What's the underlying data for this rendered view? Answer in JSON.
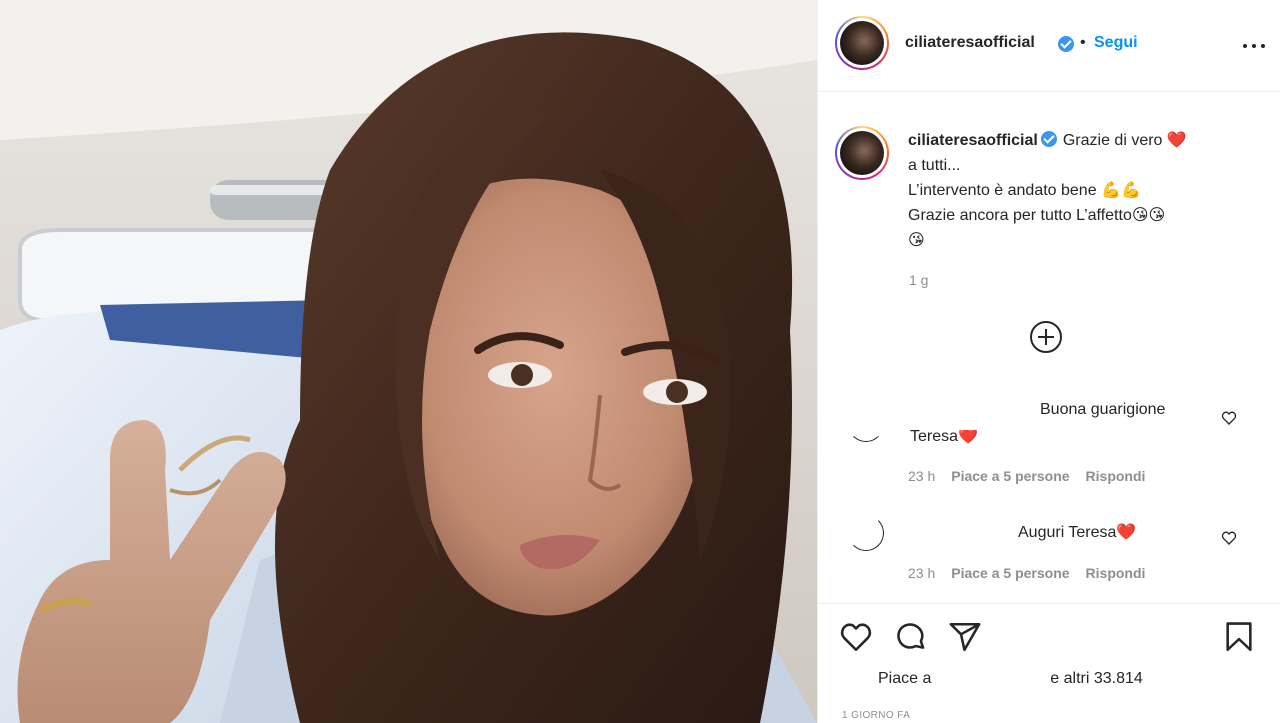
{
  "post": {
    "author": "ciliateresaofficial",
    "separator": "•",
    "follow_label": "Segui",
    "caption_text": "Grazie di vero ❤️\na tutti...\nL’intervento è andato bene 💪💪\nGrazie ancora per tutto L’affetto😘😘\n😘",
    "caption_time": "1 g"
  },
  "comments": [
    {
      "text_line1": "Buona guarigione",
      "text_line2": "Teresa❤️",
      "time": "23 h",
      "likes": "Piace a 5 persone",
      "reply": "Rispondi"
    },
    {
      "text_line1": "Auguri Teresa❤️",
      "time": "23 h",
      "likes": "Piace a 5 persone",
      "reply": "Rispondi"
    }
  ],
  "actions": {
    "likes_prefix": "Piace a",
    "likes_suffix": "e altri 33.814",
    "date": "1 GIORNO FA"
  },
  "colors": {
    "accent": "#0095f6",
    "verified": "#3897f0",
    "heart": "#ed4956"
  },
  "icons": [
    "like-icon",
    "comment-icon",
    "share-icon",
    "save-icon",
    "more-icon",
    "plus-icon",
    "verified-icon"
  ]
}
